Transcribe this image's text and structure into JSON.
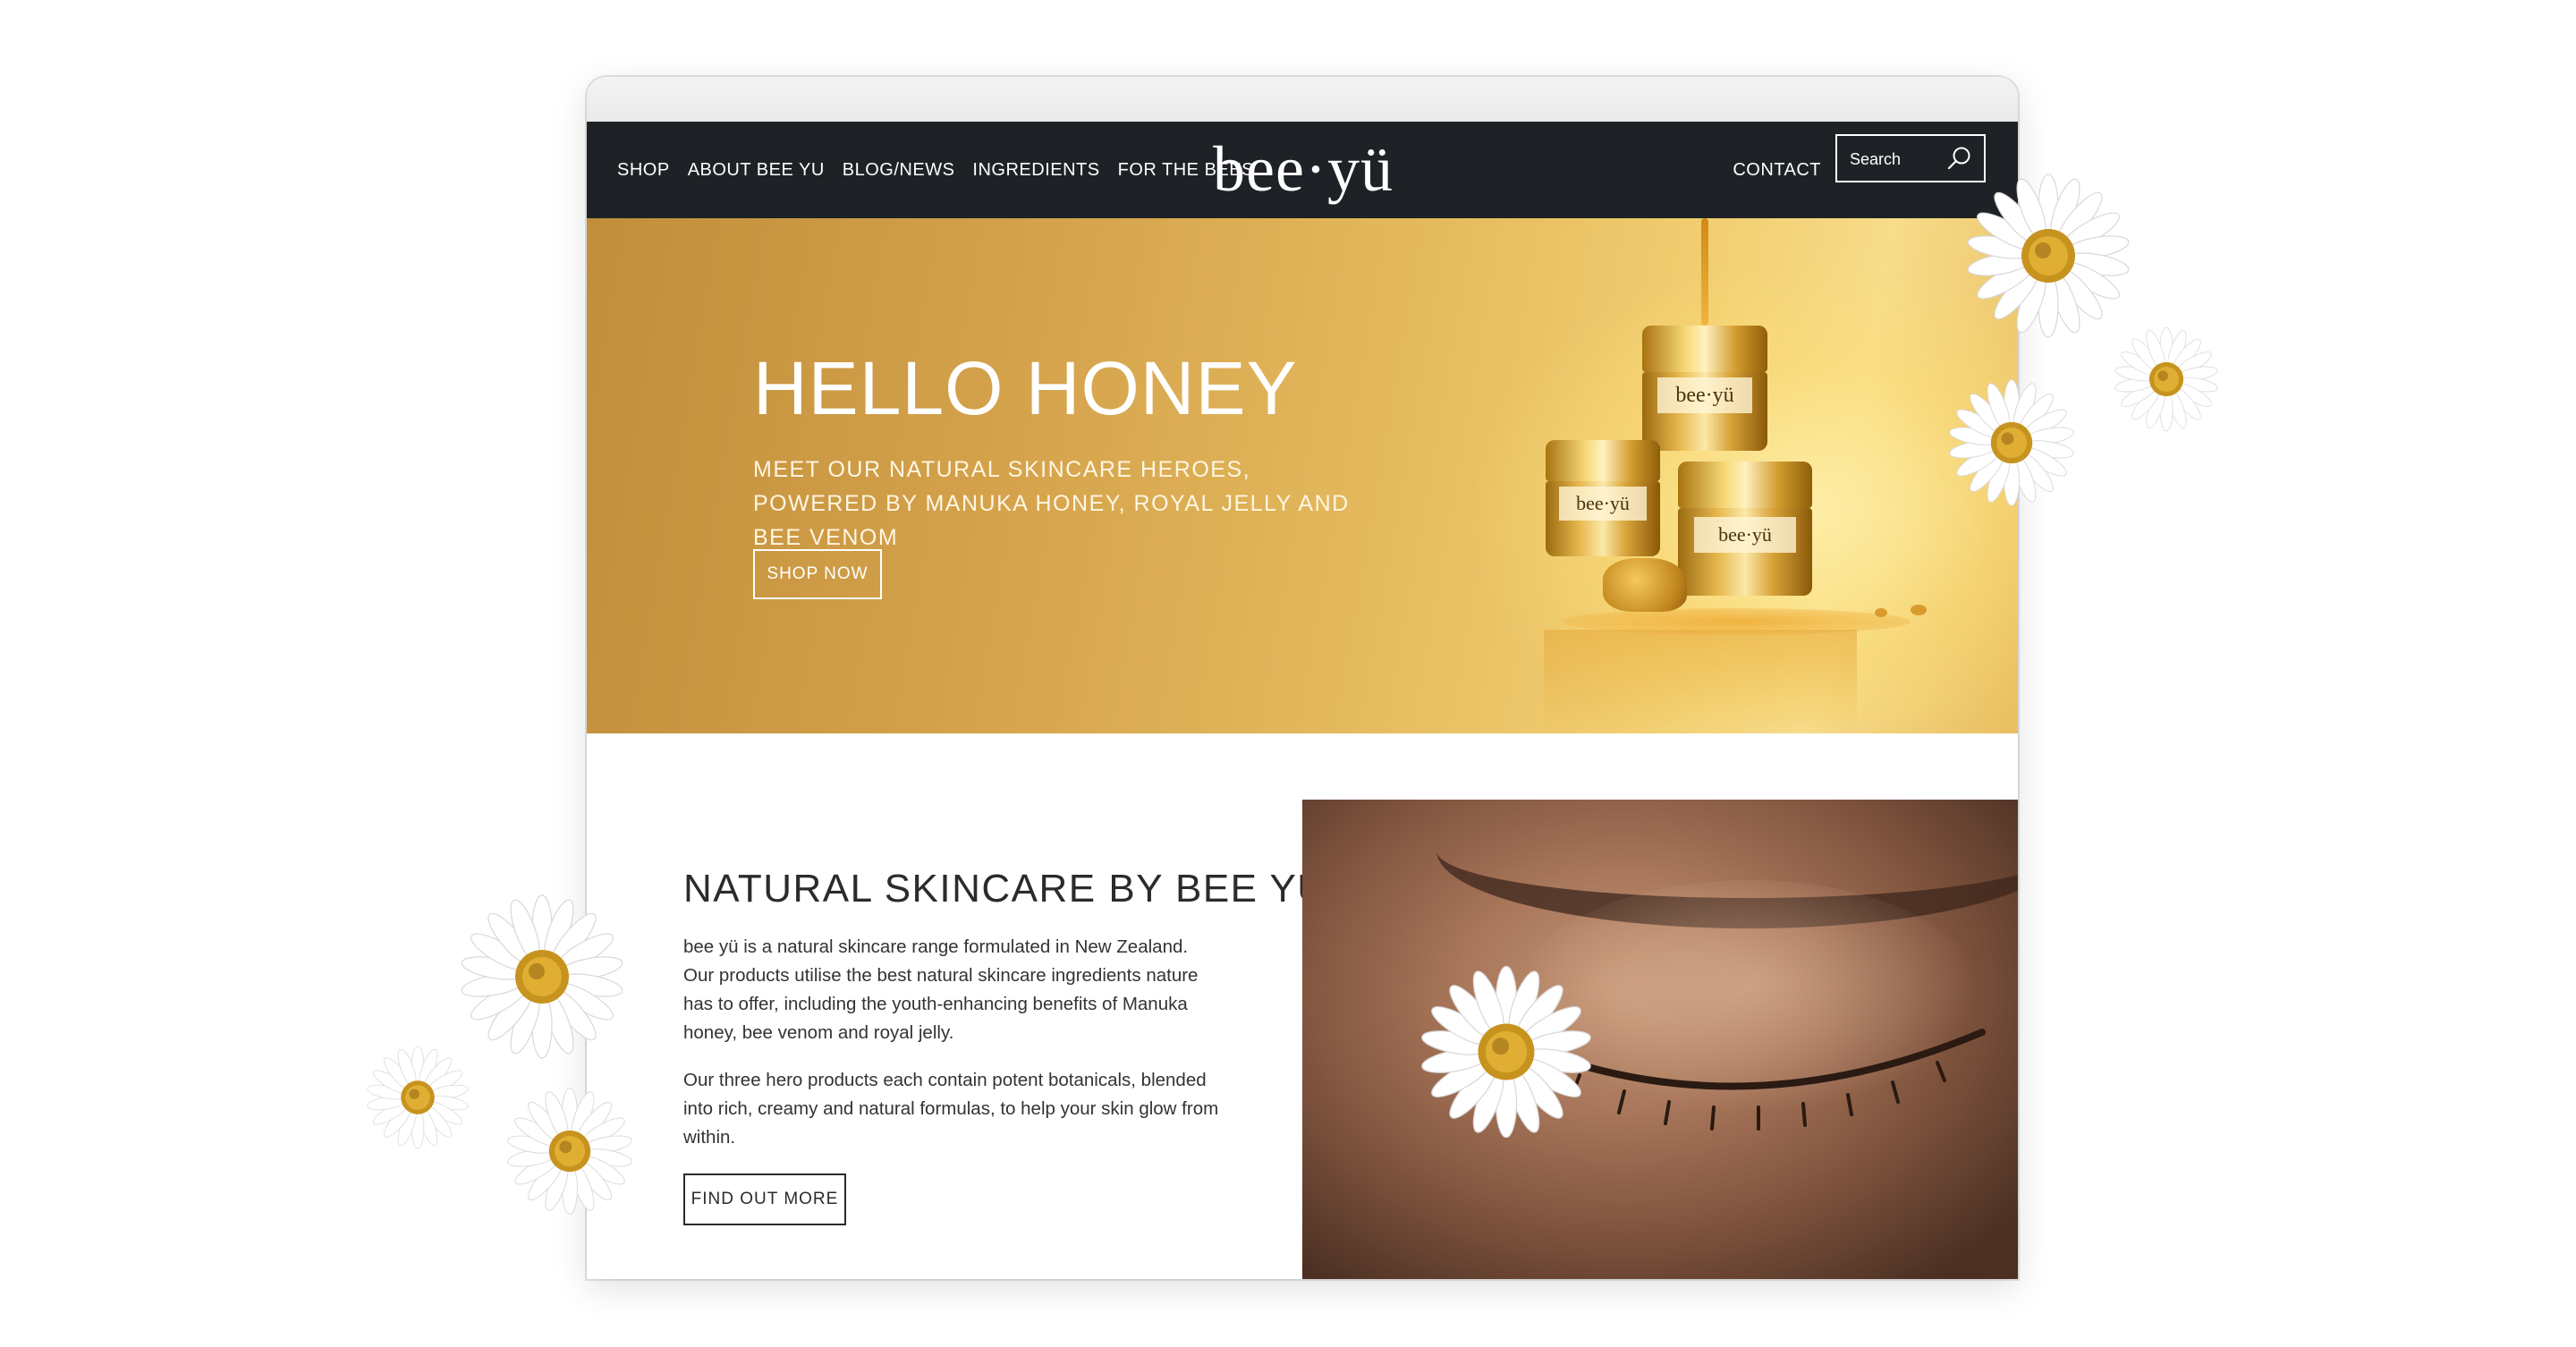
{
  "nav": {
    "links": [
      "SHOP",
      "ABOUT BEE YU",
      "BLOG/NEWS",
      "INGREDIENTS",
      "FOR THE BEES"
    ],
    "logo": "bee·yü",
    "contact": "CONTACT",
    "search_placeholder": "Search"
  },
  "hero": {
    "title": "HELLO HONEY",
    "subtitle": "MEET OUR NATURAL SKINCARE HEROES, POWERED BY MANUKA HONEY, ROYAL JELLY AND BEE VENOM",
    "button": "SHOP NOW",
    "jar_label": "bee·yü"
  },
  "about": {
    "title": "NATURAL SKINCARE BY BEE YÜ",
    "paragraph1": "bee yü is a natural skincare range formulated in New Zealand. Our products utilise the best natural skincare ingredients nature has to offer, including the youth-enhancing benefits of Manuka honey, bee venom and royal jelly.",
    "paragraph2": "Our three hero products each contain potent botanicals, blended into rich, creamy and natural formulas, to help your skin glow from within.",
    "button": "FIND OUT MORE"
  },
  "colors": {
    "nav_bg": "#1e2125",
    "hero_gold": "#d9a84c",
    "text_dark": "#2b2b2b"
  },
  "icons": [
    "search-icon",
    "daisy-flower"
  ]
}
